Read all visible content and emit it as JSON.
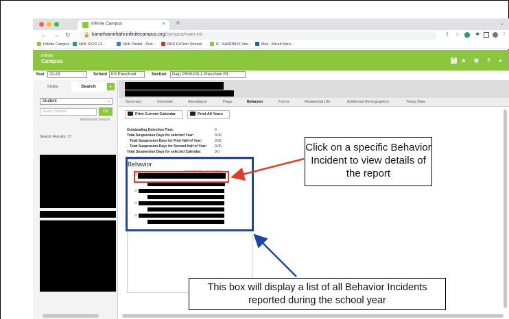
{
  "browser": {
    "tab_title": "Infinite Campus",
    "tab_close": "×",
    "new_tab": "+",
    "tab_menu": "⌄",
    "url_host": "kamehamehahi.infinitecampus.org",
    "url_path": "/campus/main.xsl",
    "bookmarks": [
      "Infinite Campus",
      "NKK SY22-23...",
      "NKK Padlet - Prof...",
      "NKK EdTech Stream",
      "IC -SANDBOX Site...",
      "Mail - Micah Mizu..."
    ]
  },
  "colors": {
    "ic_green": "#8cc63f",
    "annotation_blue": "#1846a5",
    "annotation_red": "#e23a2a"
  },
  "app": {
    "logo_top": "Infinite",
    "logo_bottom": "Campus",
    "year_label": "Year",
    "year_value": "22-23",
    "school_label": "School",
    "school_value": "KS Preschool",
    "section_label": "Section",
    "section_value": "Day) PS00103-1 Preschool P3"
  },
  "search": {
    "tabs": [
      "Index",
      "Search"
    ],
    "plus": "+",
    "type_value": "Student",
    "placeholder": "Search Student",
    "go_label": "Go",
    "advanced_label": "Advanced Search",
    "results_label": "Search Results: 17"
  },
  "main": {
    "tabs": [
      "Summary",
      "Schedule",
      "Attendance",
      "Flags",
      "Behavior",
      "Forms",
      "Residential Life",
      "Additional Demographics",
      "Today Data"
    ],
    "print_calendar": "Print Current Calendar",
    "print_all": "Print All Years",
    "stats": [
      {
        "label": "Outstanding Detention Time:",
        "value": "0"
      },
      {
        "label": "Total Suspension Days for selected Year:",
        "value": "0.00"
      },
      {
        "label": "Total Suspension Days for First Half of Year:",
        "value": "0.00"
      },
      {
        "label": "Total Suspension Days for Second Half of Year:",
        "value": "0.00"
      },
      {
        "label": "Total Suspension Days for selected Calendar:",
        "value": "0.0"
      }
    ],
    "behavior_title": "Behavior",
    "incident_summary": "(4 Incident(s), 4 Event(s))"
  },
  "annotations": {
    "top_callout": "Click on a specific Behavior Incident to view details of the report",
    "bottom_callout": "This box will display a list of all Behavior Incidents reported during the school year"
  }
}
